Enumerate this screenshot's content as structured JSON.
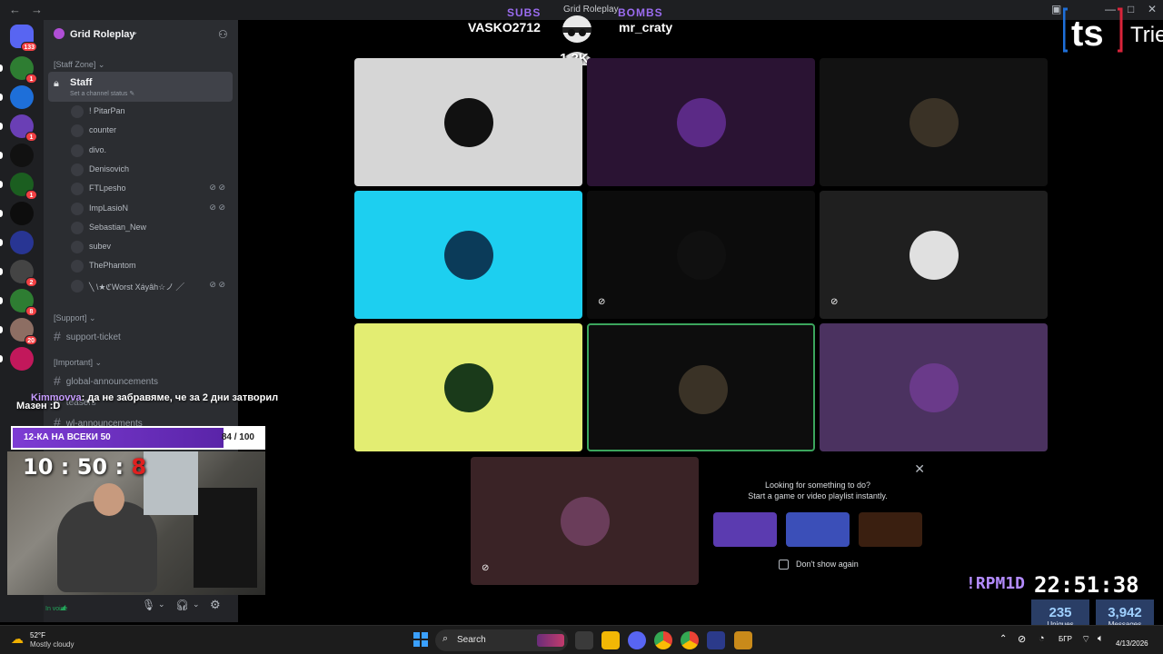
{
  "window": {
    "title": "Grid Roleplay"
  },
  "rail": {
    "servers": [
      {
        "name": "direct-messages",
        "badge": "133",
        "color": "#5865f2"
      },
      {
        "name": "server-1",
        "badge": "1",
        "color": "#2e7d32"
      },
      {
        "name": "server-2",
        "badge": "",
        "color": "#1e6fd9"
      },
      {
        "name": "server-3",
        "badge": "1",
        "color": "#6a3fb5"
      },
      {
        "name": "server-4",
        "badge": "",
        "color": "#111111"
      },
      {
        "name": "server-5",
        "badge": "1",
        "color": "#1b5e20"
      },
      {
        "name": "server-6",
        "badge": "",
        "color": "#0d0d0d"
      },
      {
        "name": "server-7",
        "badge": "",
        "color": "#283593"
      },
      {
        "name": "server-8",
        "badge": "2",
        "color": "#444444"
      },
      {
        "name": "server-9",
        "badge": "8",
        "color": "#2e7d32"
      },
      {
        "name": "server-10",
        "badge": "20",
        "color": "#8d6e63"
      },
      {
        "name": "server-11",
        "badge": "",
        "color": "#c2185b"
      }
    ]
  },
  "sidebar": {
    "server_name": "Grid Roleplay",
    "categories": {
      "staff_zone": "[Staff Zone]",
      "support": "[Support]",
      "important": "[Important]"
    },
    "staff_channel": {
      "name": "Staff",
      "status_placeholder": "Set a channel status"
    },
    "voice_users": [
      {
        "name": "! PitarPan",
        "muted": false
      },
      {
        "name": "counter",
        "muted": false
      },
      {
        "name": "divo.",
        "muted": false
      },
      {
        "name": "Denisovich",
        "muted": false
      },
      {
        "name": "FTLpesho",
        "muted": true
      },
      {
        "name": "ImpLasioN",
        "muted": true
      },
      {
        "name": "Sebastian_New",
        "muted": false
      },
      {
        "name": "subev",
        "muted": false
      },
      {
        "name": "ThePhantom",
        "muted": false
      },
      {
        "name": "╲ \\★ℭWorst Xáyâh☆ノ ╱",
        "muted": true
      }
    ],
    "text_channels": {
      "support_ticket": "support-ticket",
      "global_announcements": "global-announcements",
      "teasers": "teasers",
      "wl_announcements": "wl-announcements"
    },
    "user_panel": {
      "status": "In voice"
    }
  },
  "overlay": {
    "chat_user": "Kimmovva",
    "chat_message": ": да не забравяме, че за 2 дни затворил",
    "chat_line2": "Мазен :D",
    "goal_label": "12-КА НА ВСЕКИ 50",
    "goal_count": "84 / 100",
    "goal_fraction": 0.84,
    "cam_clock_main": "10 : 50 :",
    "cam_clock_sec": "8",
    "subs_label": "SUBS",
    "subs_name": "VASKO2712",
    "bombs_label": "BOMBS",
    "bombs_name": "mr_craty",
    "center_count": "1.2K",
    "ts_text": "Trie",
    "rpm": "!RPM1D",
    "clock": "22:51:38",
    "uniques_value": "235",
    "uniques_label": "Uniques",
    "messages_value": "3,942",
    "messages_label": "Messages"
  },
  "tiles": [
    {
      "name": "tile-pitarpan",
      "bg": "#d6d6d6",
      "avatar": "#111111",
      "muted": false,
      "speaking": false
    },
    {
      "name": "tile-counter",
      "bg": "#2a1333",
      "avatar": "#5b2a86",
      "muted": false,
      "speaking": false
    },
    {
      "name": "tile-skull-laurel",
      "bg": "#121212",
      "avatar": "#3a3226",
      "muted": false,
      "speaking": false
    },
    {
      "name": "tile-denisovich",
      "bg": "#1dcff0",
      "avatar": "#0b3b59",
      "muted": false,
      "speaking": false
    },
    {
      "name": "tile-soldier",
      "bg": "#0c0c0c",
      "avatar": "#101010",
      "muted": true,
      "speaking": false
    },
    {
      "name": "tile-masked",
      "bg": "#1f1f1f",
      "avatar": "#e0e0e0",
      "muted": true,
      "speaking": false
    },
    {
      "name": "tile-kick",
      "bg": "#e3ed72",
      "avatar": "#1a3a1a",
      "muted": false,
      "speaking": false
    },
    {
      "name": "tile-skull-laurel-2",
      "bg": "#0d0d0d",
      "avatar": "#3a3226",
      "muted": false,
      "speaking": true
    },
    {
      "name": "tile-phantom",
      "bg": "#4b3260",
      "avatar": "#6a3a8a",
      "muted": false,
      "speaking": false
    },
    {
      "name": "tile-ninja",
      "bg": "#3a2326",
      "avatar": "#6a3d5a",
      "muted": true,
      "speaking": false
    }
  ],
  "activity": {
    "line1": "Looking for something to do?",
    "line2": "Start a game or video playlist instantly.",
    "cards": [
      {
        "name": "activity-mission-control",
        "color": "#5b3bb0"
      },
      {
        "name": "activity-know-what-i-meme",
        "color": "#3b4fb8"
      },
      {
        "name": "activity-land-io",
        "color": "#3a1f10"
      }
    ],
    "dont_show": "Don't show again"
  },
  "taskbar": {
    "weather_temp": "52°F",
    "weather_desc": "Mostly cloudy",
    "search_label": "Search",
    "lang": "БГР",
    "date": "4/13/2026"
  }
}
